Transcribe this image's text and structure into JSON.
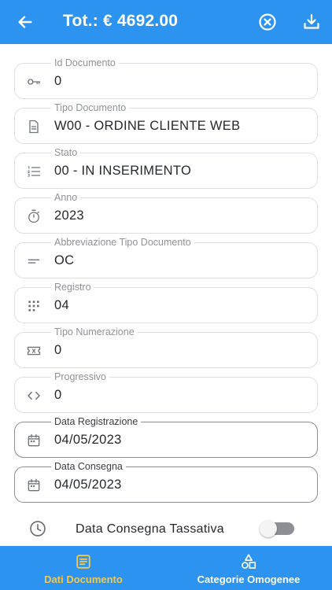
{
  "header": {
    "title": "Tot.: € 4692.00",
    "back_icon": "arrow-left-icon",
    "cancel_icon": "cancel-circle-icon",
    "download_icon": "download-icon",
    "background": "#2c94f0"
  },
  "fields": [
    {
      "label": "Id Documento",
      "value": "0",
      "icon": "key-icon",
      "editable": false
    },
    {
      "label": "Tipo Documento",
      "value": "W00 - ORDINE CLIENTE WEB",
      "icon": "document-icon",
      "editable": false
    },
    {
      "label": "Stato",
      "value": "00 - IN INSERIMENTO",
      "icon": "numbered-list-icon",
      "editable": false
    },
    {
      "label": "Anno",
      "value": "2023",
      "icon": "timer-icon",
      "editable": false
    },
    {
      "label": "Abbreviazione Tipo Documento",
      "value": "OC",
      "icon": "short-text-icon",
      "editable": false
    },
    {
      "label": "Registro",
      "value": "04",
      "icon": "dialpad-icon",
      "editable": false
    },
    {
      "label": "Tipo Numerazione",
      "value": "0",
      "icon": "ticket-icon",
      "editable": false
    },
    {
      "label": "Progressivo",
      "value": "0",
      "icon": "code-icon",
      "editable": false
    },
    {
      "label": "Data Registrazione",
      "value": "04/05/2023",
      "icon": "calendar-icon",
      "editable": true
    },
    {
      "label": "Data Consegna",
      "value": "04/05/2023",
      "icon": "calendar-icon",
      "editable": true
    }
  ],
  "toggle": {
    "label": "Data Consegna Tassativa",
    "icon": "clock-icon",
    "on": false
  },
  "bottom_nav": {
    "items": [
      {
        "label": "Dati Documento",
        "icon": "document-list-icon",
        "active": true
      },
      {
        "label": "Categorie Omogenee",
        "icon": "shapes-icon",
        "active": false
      }
    ],
    "active_color": "#f3c84b"
  }
}
